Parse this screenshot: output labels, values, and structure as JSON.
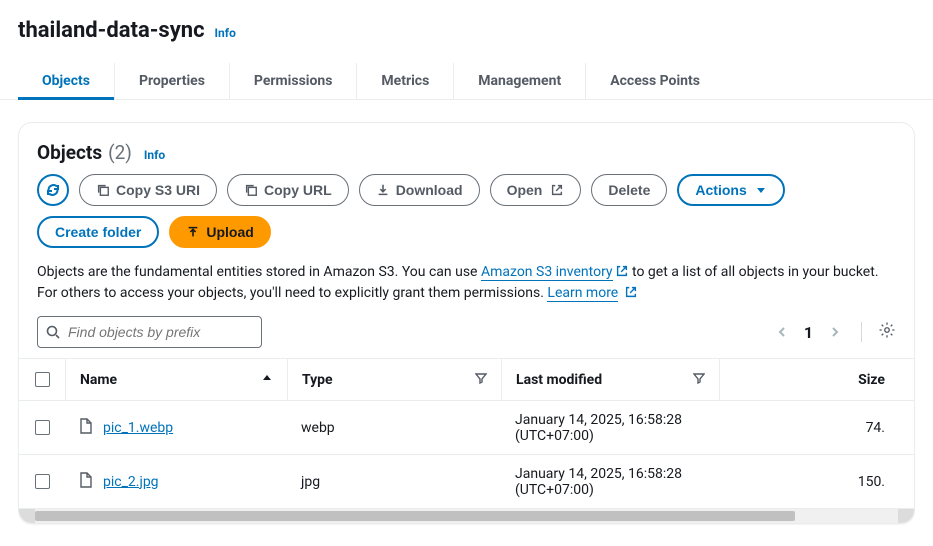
{
  "header": {
    "bucket_name": "thailand-data-sync",
    "info_label": "Info"
  },
  "tabs": [
    {
      "id": "objects",
      "label": "Objects",
      "active": true
    },
    {
      "id": "properties",
      "label": "Properties",
      "active": false
    },
    {
      "id": "permissions",
      "label": "Permissions",
      "active": false
    },
    {
      "id": "metrics",
      "label": "Metrics",
      "active": false
    },
    {
      "id": "management",
      "label": "Management",
      "active": false
    },
    {
      "id": "access-points",
      "label": "Access Points",
      "active": false
    }
  ],
  "objects_panel": {
    "title": "Objects",
    "count_display": "(2)",
    "info_label": "Info",
    "toolbar": {
      "refresh_label": "",
      "copy_s3_uri": "Copy S3 URI",
      "copy_url": "Copy URL",
      "download": "Download",
      "open": "Open",
      "delete": "Delete",
      "actions": "Actions",
      "create_folder": "Create folder",
      "upload": "Upload"
    },
    "help_prefix": "Objects are the fundamental entities stored in Amazon S3. You can use ",
    "help_inventory_link": "Amazon S3 inventory",
    "help_mid": " to get a list of all objects in your bucket. For others to access your objects, you'll need to explicitly grant them permissions. ",
    "help_learn_more": "Learn more",
    "search_placeholder": "Find objects by prefix",
    "page_number": "1",
    "columns": {
      "name": "Name",
      "type": "Type",
      "modified": "Last modified",
      "size": "Size"
    },
    "rows": [
      {
        "name": "pic_1.webp",
        "type": "webp",
        "modified": "January 14, 2025, 16:58:28 (UTC+07:00)",
        "size": "74."
      },
      {
        "name": "pic_2.jpg",
        "type": "jpg",
        "modified": "January 14, 2025, 16:58:28 (UTC+07:00)",
        "size": "150."
      }
    ]
  }
}
